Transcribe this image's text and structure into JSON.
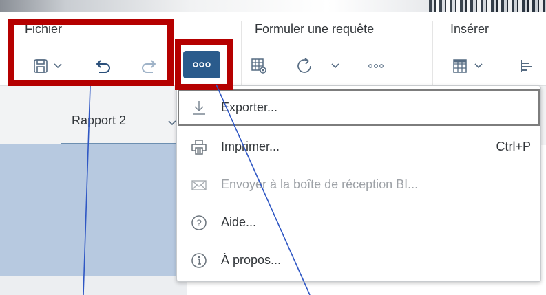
{
  "toolbar": {
    "groups": [
      {
        "label": "Fichier"
      },
      {
        "label": "Formuler une requête"
      },
      {
        "label": "Insérer"
      }
    ],
    "icons": {
      "save": "save-icon",
      "undo": "undo-icon",
      "redo": "redo-icon",
      "more": "more-icon",
      "table": "table-settings-icon",
      "refresh": "refresh-icon",
      "grid": "grid-icon",
      "align": "align-icon"
    }
  },
  "tabs": [
    {
      "label": "Rapport 2"
    }
  ],
  "menu": {
    "items": [
      {
        "label": "Exporter...",
        "icon": "download-icon",
        "enabled": true,
        "focused": true
      },
      {
        "label": "Imprimer...",
        "shortcut": "Ctrl+P",
        "icon": "printer-icon",
        "enabled": true
      },
      {
        "label": "Envoyer à la boîte de réception BI...",
        "icon": "envelope-icon",
        "enabled": false
      },
      {
        "label": "Aide...",
        "icon": "help-icon",
        "enabled": true
      },
      {
        "label": "À propos...",
        "icon": "info-icon",
        "enabled": true
      }
    ]
  },
  "colors": {
    "accent": "#2a5b8c",
    "highlight_box": "#b50000",
    "annotation_line": "#2f57c4",
    "canvas": "#b7c9e0"
  }
}
